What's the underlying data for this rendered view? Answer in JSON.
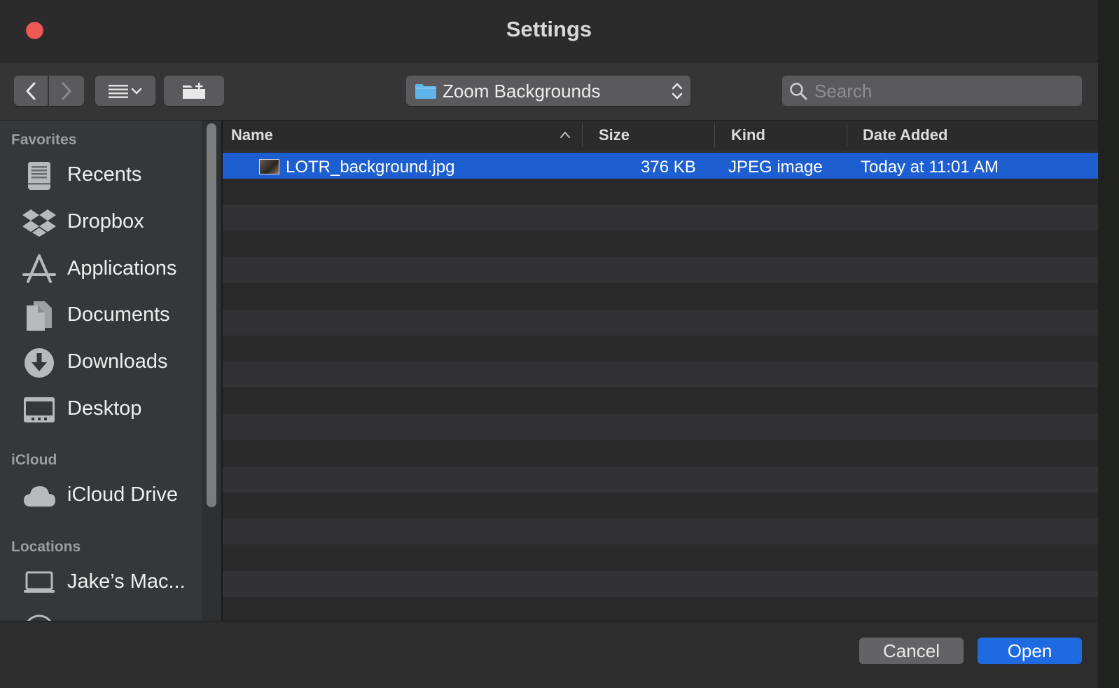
{
  "window": {
    "title": "Settings"
  },
  "toolbar": {
    "path_label": "Zoom Backgrounds",
    "search_placeholder": "Search"
  },
  "sidebar": {
    "sections": [
      {
        "title": "Favorites"
      },
      {
        "title": "iCloud"
      },
      {
        "title": "Locations"
      }
    ],
    "items": [
      {
        "label": "Recents",
        "icon": "recents-icon"
      },
      {
        "label": "Dropbox",
        "icon": "dropbox-icon"
      },
      {
        "label": "Applications",
        "icon": "applications-icon"
      },
      {
        "label": "Documents",
        "icon": "documents-icon"
      },
      {
        "label": "Downloads",
        "icon": "downloads-icon"
      },
      {
        "label": "Desktop",
        "icon": "desktop-icon"
      },
      {
        "label": "iCloud Drive",
        "icon": "cloud-icon"
      },
      {
        "label": "Jake’s Mac...",
        "icon": "laptop-icon"
      }
    ]
  },
  "filelist": {
    "columns": [
      {
        "label": "Name"
      },
      {
        "label": "Size"
      },
      {
        "label": "Kind"
      },
      {
        "label": "Date Added"
      }
    ],
    "files": [
      {
        "name": "LOTR_background.jpg",
        "size": "376 KB",
        "kind": "JPEG image",
        "date_added": "Today at 11:01 AM",
        "selected": true
      }
    ]
  },
  "buttons": {
    "cancel": "Cancel",
    "open": "Open"
  },
  "colors": {
    "selection": "#1d5fd0",
    "primary_button": "#1f6ae0",
    "close_button": "#ed5a55",
    "folder": "#5fb4ec"
  }
}
